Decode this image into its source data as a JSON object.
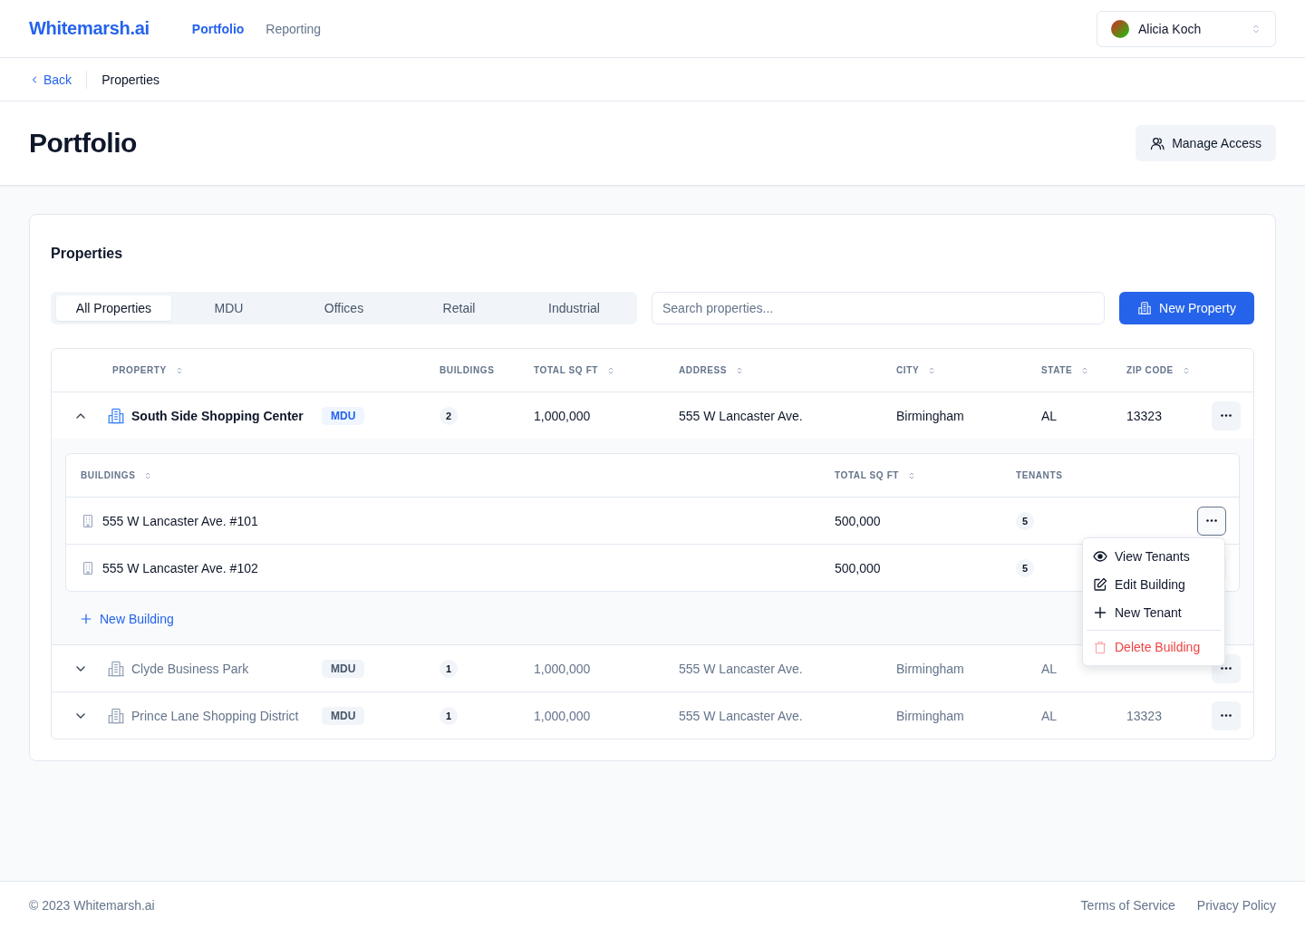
{
  "nav": {
    "brand": "Whitemarsh.ai",
    "links": [
      {
        "label": "Portfolio",
        "selected": true
      },
      {
        "label": "Reporting",
        "selected": false
      }
    ],
    "user": {
      "name": "Alicia Koch"
    }
  },
  "breadcrumb": {
    "back": "Back",
    "current": "Properties"
  },
  "page": {
    "title": "Portfolio",
    "action": "Manage Access"
  },
  "properties": {
    "title": "Properties",
    "tabs": [
      {
        "label": "All Properties",
        "selected": true
      },
      {
        "label": "MDU",
        "selected": false
      },
      {
        "label": "Offices",
        "selected": false
      },
      {
        "label": "Retail",
        "selected": false
      },
      {
        "label": "Industrial",
        "selected": false
      }
    ],
    "search": {
      "placeholder": "Search properties..."
    },
    "new_button": "New Property",
    "columns": [
      {
        "label": "PROPERTY",
        "sortable": true
      },
      {
        "label": "BUILDINGS",
        "sortable": false
      },
      {
        "label": "TOTAL SQ FT",
        "sortable": true
      },
      {
        "label": "ADDRESS",
        "sortable": true
      },
      {
        "label": "CITY",
        "sortable": true
      },
      {
        "label": "STATE",
        "sortable": true
      },
      {
        "label": "ZIP CODE",
        "sortable": true
      }
    ],
    "rows": [
      {
        "name": "South Side Shopping Center",
        "tag": "MDU",
        "buildings": "2",
        "sqft": "1,000,000",
        "address": "555 W Lancaster Ave.",
        "city": "Birmingham",
        "state": "AL",
        "zip": "13323",
        "expanded": true,
        "detail": {
          "columns": [
            {
              "label": "BUILDINGS",
              "sortable": true
            },
            {
              "label": "TOTAL SQ FT",
              "sortable": true
            },
            {
              "label": "TENANTS",
              "sortable": false
            }
          ],
          "rows": [
            {
              "name": "555 W Lancaster Ave. #101",
              "sqft": "500,000",
              "tenants": "5",
              "menu": {
                "items": [
                  {
                    "label": "View Tenants",
                    "kind": "view"
                  },
                  {
                    "label": "Edit Building",
                    "kind": "edit"
                  },
                  {
                    "label": "New Tenant",
                    "kind": "add"
                  },
                  {
                    "label": "Delete Building",
                    "kind": "delete"
                  }
                ]
              }
            },
            {
              "name": "555 W Lancaster Ave. #102",
              "sqft": "500,000",
              "tenants": "5"
            }
          ],
          "add_button": "New Building"
        }
      },
      {
        "name": "Clyde Business Park",
        "tag": "MDU",
        "buildings": "1",
        "sqft": "1,000,000",
        "address": "555 W Lancaster Ave.",
        "city": "Birmingham",
        "state": "AL",
        "expanded": false
      },
      {
        "name": "Prince Lane Shopping District",
        "tag": "MDU",
        "buildings": "1",
        "sqft": "1,000,000",
        "address": "555 W Lancaster Ave.",
        "city": "Birmingham",
        "state": "AL",
        "zip": "13323",
        "expanded": false
      }
    ]
  },
  "footer": {
    "copyright": "© 2023 Whitemarsh.ai",
    "links": [
      "Terms of Service",
      "Privacy Policy"
    ]
  }
}
